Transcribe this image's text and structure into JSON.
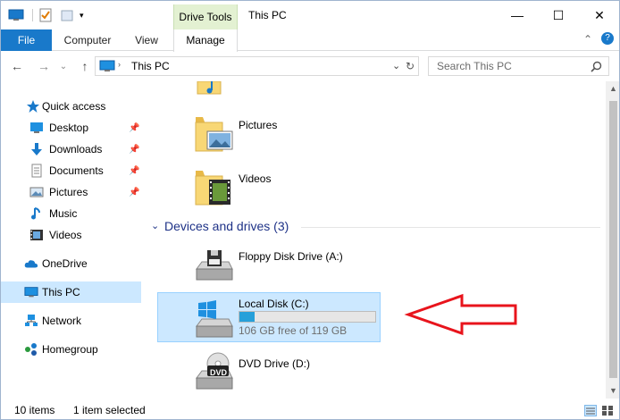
{
  "window": {
    "title": "This PC",
    "context_tab": "Drive Tools",
    "minimize": "—",
    "maximize": "☐",
    "close": "✕",
    "help": "?",
    "collapse": "⌃"
  },
  "ribbon": {
    "tabs": [
      "File",
      "Computer",
      "View",
      "Manage"
    ]
  },
  "address": {
    "back": "←",
    "forward": "→",
    "recent": "⌄",
    "up": "↑",
    "path": "This PC",
    "dropdown": "⌄",
    "refresh": "↻",
    "search_placeholder": "Search This PC"
  },
  "nav": {
    "quick_access": "Quick access",
    "pinned": [
      {
        "label": "Desktop",
        "icon": "desktop-icon"
      },
      {
        "label": "Downloads",
        "icon": "downloads-icon"
      },
      {
        "label": "Documents",
        "icon": "documents-icon"
      },
      {
        "label": "Pictures",
        "icon": "pictures-icon"
      }
    ],
    "recent": [
      {
        "label": "Music",
        "icon": "music-icon"
      },
      {
        "label": "Videos",
        "icon": "videos-icon"
      }
    ],
    "onedrive": "OneDrive",
    "this_pc": "This PC",
    "network": "Network",
    "homegroup": "Homegroup"
  },
  "content": {
    "folders": [
      {
        "label": "Pictures",
        "icon": "pictures-folder-icon"
      },
      {
        "label": "Videos",
        "icon": "videos-folder-icon"
      }
    ],
    "devices_header": "Devices and drives (3)",
    "drives": [
      {
        "label": "Floppy Disk Drive (A:)",
        "icon": "floppy-drive-icon"
      },
      {
        "label": "Local Disk (C:)",
        "icon": "windows-drive-icon",
        "free_text": "106 GB free of 119 GB",
        "used_fraction": 0.11
      },
      {
        "label": "DVD Drive (D:)",
        "icon": "dvd-drive-icon",
        "badge": "DVD"
      }
    ],
    "arrow_color": "#e8141c"
  },
  "status": {
    "items": "10 items",
    "selected": "1 item selected"
  },
  "colors": {
    "accent": "#1979ca",
    "selection": "#cce8ff",
    "context_tab": "#e3f1d2",
    "progress": "#26a0da"
  }
}
